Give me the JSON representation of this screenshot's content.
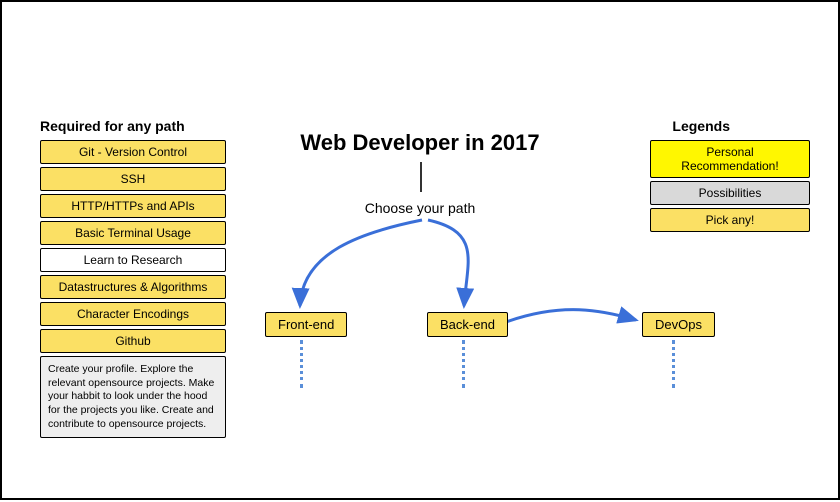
{
  "title": "Web Developer in 2017",
  "choose_label": "Choose your path",
  "required": {
    "heading": "Required for any path",
    "items": [
      "Git - Version Control",
      "SSH",
      "HTTP/HTTPs and APIs",
      "Basic Terminal Usage",
      "Learn to Research",
      "Datastructures & Algorithms",
      "Character Encodings",
      "Github"
    ],
    "github_desc": "Create your profile. Explore the relevant opensource projects. Make your habbit to look under the hood for the projects you like. Create and contribute to opensource projects."
  },
  "legends": {
    "heading": "Legends",
    "items": [
      {
        "label": "Personal Recommendation!",
        "style": "bright-yellow"
      },
      {
        "label": "Possibilities",
        "style": "gray"
      },
      {
        "label": "Pick any!",
        "style": "yellow"
      }
    ]
  },
  "paths": {
    "frontend": "Front-end",
    "backend": "Back-end",
    "devops": "DevOps"
  }
}
